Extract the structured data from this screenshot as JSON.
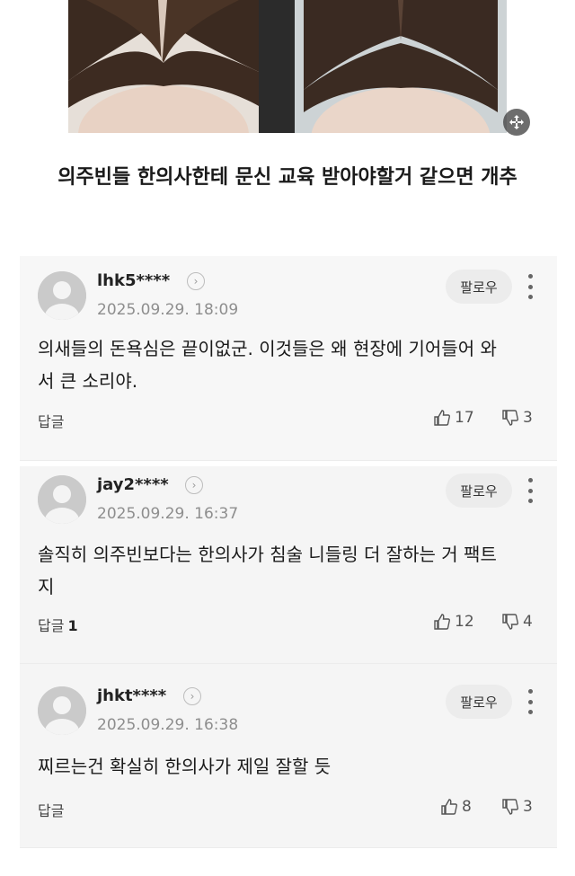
{
  "post": {
    "title": "의주빈들 한의사한테 문신 교육 받아야할거 같으면 개추"
  },
  "follow_label": "팔로우",
  "reply_label": "답글",
  "comments": [
    {
      "username": "lhk5****",
      "date": "2025.09.29. 18:09",
      "text": "의새들의 돈욕심은 끝이없군. 이것들은 왜 현장에 기어들어 와서 큰 소리야.",
      "reply_count": "",
      "likes": "17",
      "dislikes": "3"
    },
    {
      "username": "jay2****",
      "date": "2025.09.29. 16:37",
      "text": "솔직히 의주빈보다는 한의사가 침술 니들링 더 잘하는 거 팩트지",
      "reply_count": "1",
      "likes": "12",
      "dislikes": "4"
    },
    {
      "username": "jhkt****",
      "date": "2025.09.29. 16:38",
      "text": "찌르는건 확실히 한의사가 제일 잘할 듯",
      "reply_count": "",
      "likes": "8",
      "dislikes": "3"
    }
  ]
}
